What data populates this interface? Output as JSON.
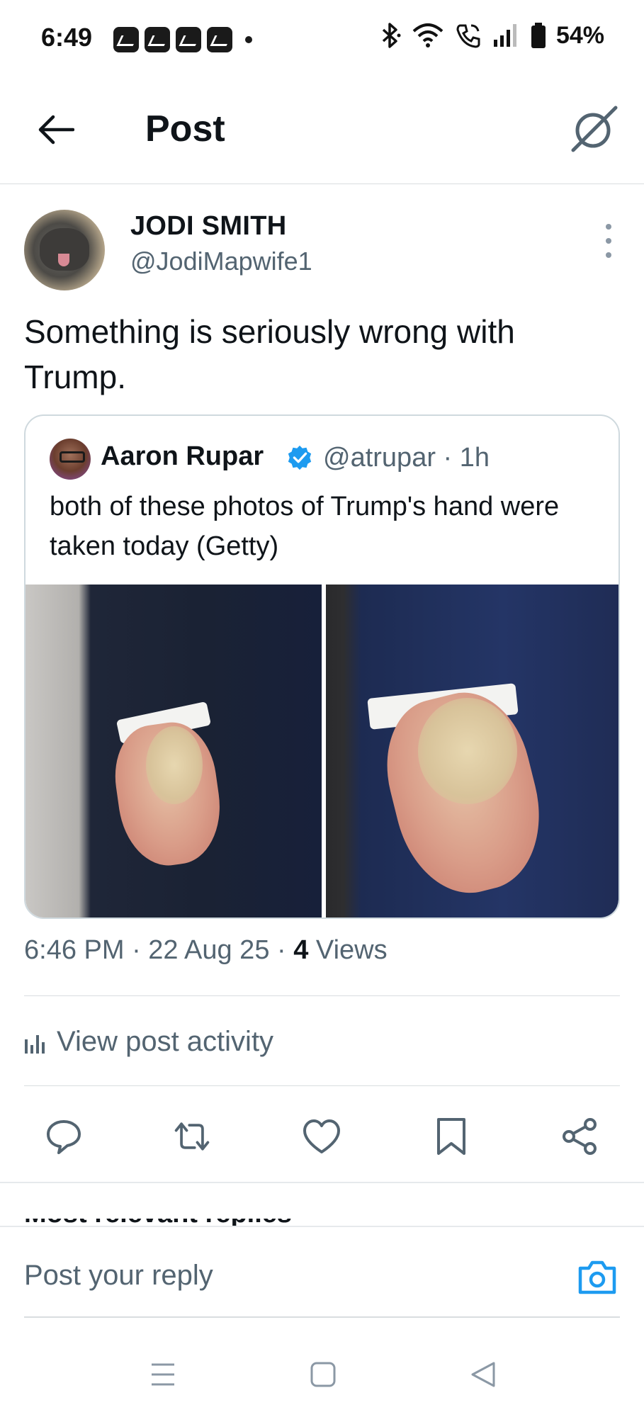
{
  "status_bar": {
    "time": "6:49",
    "battery": "54%",
    "notification_icons": [
      "notification-icon",
      "notification-icon",
      "notification-icon",
      "notification-icon"
    ]
  },
  "header": {
    "title": "Post",
    "back_icon": "arrow-left-icon",
    "grok_icon": "grok-icon"
  },
  "post": {
    "author_name": "JODI SMITH",
    "author_handle": "@JodiMapwife1",
    "text": "Something is seriously wrong with Trump.",
    "quoted": {
      "author_name": "Aaron Rupar",
      "verified": true,
      "meta": "@atrupar · 1h",
      "text": "both of these photos of Trump's hand were taken today (Getty)",
      "image_count": 2
    },
    "timestamp": "6:46 PM · 22 Aug 25 · ",
    "views_count": "4",
    "views_label": " Views",
    "activity_label": "View post activity"
  },
  "actions": [
    "reply-icon",
    "repost-icon",
    "like-icon",
    "bookmark-icon",
    "share-icon"
  ],
  "reply": {
    "placeholder": "Post your reply",
    "partial_heading": "Most relevant replies"
  },
  "colors": {
    "text": "#0f1419",
    "secondary": "#536471",
    "accent": "#1d9bf0",
    "divider": "#d9dde0"
  }
}
